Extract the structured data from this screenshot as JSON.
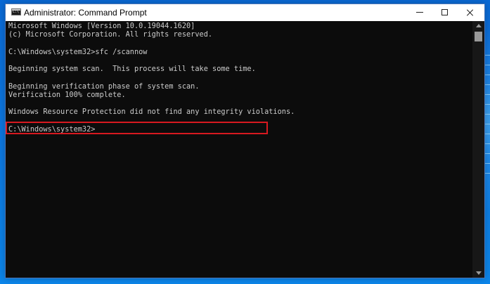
{
  "desktop": {
    "accent": "#0b78e3"
  },
  "window": {
    "title": "Administrator: Command Prompt",
    "icon": "command-prompt-icon",
    "controls": {
      "minimize_icon": "minimize-icon",
      "maximize_icon": "maximize-icon",
      "close_icon": "close-icon"
    }
  },
  "console": {
    "lines": [
      "Microsoft Windows [Version 10.0.19044.1620]",
      "(c) Microsoft Corporation. All rights reserved.",
      "C:\\Windows\\system32>sfc /scannow",
      "Beginning system scan.  This process will take some time.",
      "Beginning verification phase of system scan.",
      "Verification 100% complete.",
      "Windows Resource Protection did not find any integrity violations.",
      "C:\\Windows\\system32>"
    ],
    "highlight_color": "#d71920"
  },
  "scrollbar": {
    "up_icon": "scroll-up-icon",
    "down_icon": "scroll-down-icon"
  }
}
